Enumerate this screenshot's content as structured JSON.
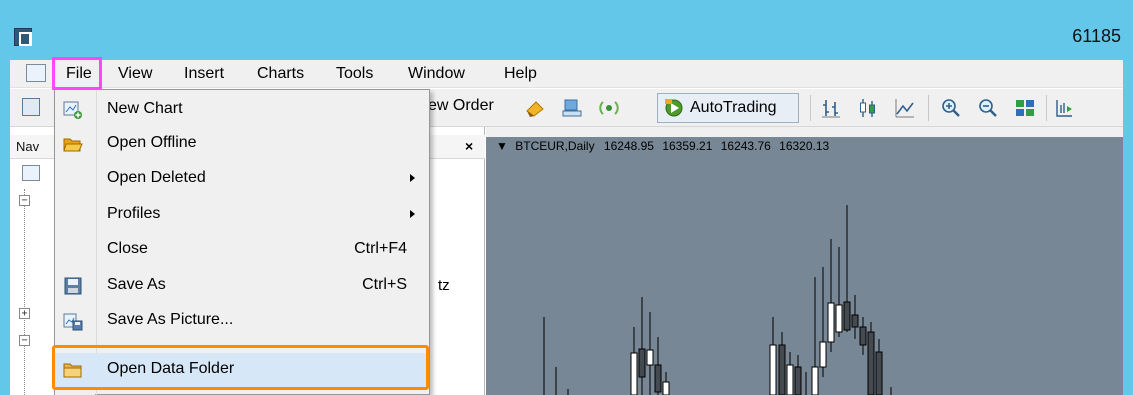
{
  "window": {
    "title": "61185"
  },
  "menubar": {
    "items": [
      "File",
      "View",
      "Insert",
      "Charts",
      "Tools",
      "Window",
      "Help"
    ]
  },
  "toolbar": {
    "new_order_label": "ew Order",
    "autotrading_label": "AutoTrading"
  },
  "navigator": {
    "title": "Nav",
    "close_glyph": "×",
    "truncated_text": "tz"
  },
  "chart": {
    "header_arrow": "▼",
    "symbol": "BTCEUR,Daily",
    "open": "16248.95",
    "high": "16359.21",
    "low": "16243.76",
    "close": "16320.13",
    "background": "#788795"
  },
  "file_menu": {
    "items": [
      {
        "label": "New Chart",
        "shortcut": "",
        "submenu": false,
        "icon": "new-chart-icon"
      },
      {
        "label": "Open Offline",
        "shortcut": "",
        "submenu": false,
        "icon": "folder-open-icon"
      },
      {
        "label": "Open Deleted",
        "shortcut": "",
        "submenu": true,
        "icon": ""
      },
      {
        "label": "Profiles",
        "shortcut": "",
        "submenu": true,
        "icon": ""
      },
      {
        "label": "Close",
        "shortcut": "Ctrl+F4",
        "submenu": false,
        "icon": ""
      },
      {
        "label": "Save As",
        "shortcut": "Ctrl+S",
        "submenu": false,
        "icon": "floppy-disk-icon"
      },
      {
        "label": "Save As Picture...",
        "shortcut": "",
        "submenu": false,
        "icon": "save-picture-icon"
      },
      {
        "label": "Open Data Folder",
        "shortcut": "",
        "submenu": false,
        "icon": "folder-icon"
      }
    ]
  },
  "colors": {
    "title_bar": "#63c7ea",
    "file_highlight": "#ff47ff",
    "open_data_folder_highlight": "#ff8c00"
  }
}
